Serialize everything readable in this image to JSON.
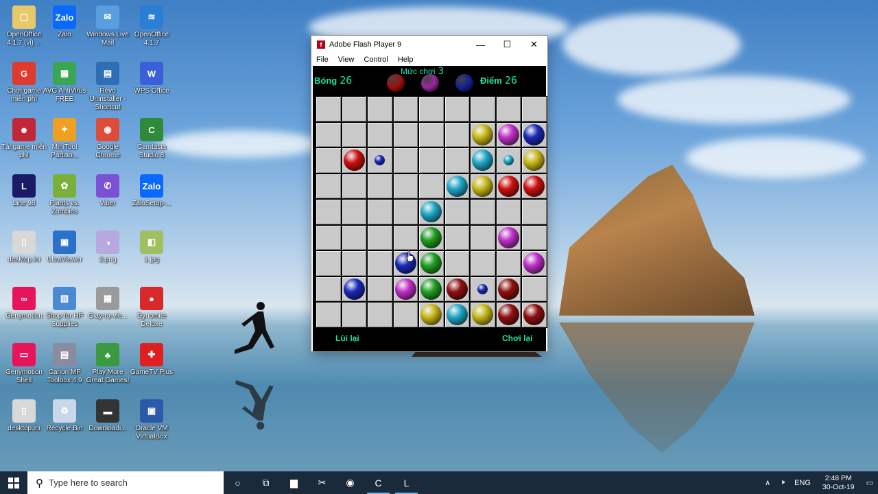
{
  "desktop": {
    "icons": [
      {
        "label": "OpenOffice 4.1.7 (vi) ...",
        "color": "#e8c86a",
        "glyph": "▢",
        "icon": "folder-icon"
      },
      {
        "label": "Zalo",
        "color": "#0a68ff",
        "glyph": "Zalo",
        "icon": "zalo-icon"
      },
      {
        "label": "Windows Live Mail",
        "color": "#5a9ee0",
        "glyph": "✉",
        "icon": "mail-icon"
      },
      {
        "label": "OpenOffice 4.1.7",
        "color": "#2a7fd4",
        "glyph": "≋",
        "icon": "openoffice-icon"
      },
      {
        "label": "Chơi game miễn phí",
        "color": "#e03a2e",
        "glyph": "G",
        "icon": "game-icon"
      },
      {
        "label": "AVG AntiVirus FREE",
        "color": "#3aa653",
        "glyph": "▦",
        "icon": "avg-icon"
      },
      {
        "label": "Revo Uninstaller - Shortcut",
        "color": "#2f6db5",
        "glyph": "▤",
        "icon": "revo-icon"
      },
      {
        "label": "WPS Office",
        "color": "#3b5fd9",
        "glyph": "W",
        "icon": "wps-icon"
      },
      {
        "label": "Tải game miễn phí",
        "color": "#c0283a",
        "glyph": "☻",
        "icon": "download-game-icon"
      },
      {
        "label": "MiniTool Partitio...",
        "color": "#f0a020",
        "glyph": "✦",
        "icon": "minitool-icon"
      },
      {
        "label": "Google Chrome",
        "color": "#dd4b39",
        "glyph": "◉",
        "icon": "chrome-icon"
      },
      {
        "label": "Camtasia Studio 8",
        "color": "#2e8b3a",
        "glyph": "C",
        "icon": "camtasia-icon"
      },
      {
        "label": "Line 98",
        "color": "#1a1a66",
        "glyph": "L",
        "icon": "line98-icon"
      },
      {
        "label": "Plants vs. Zombies",
        "color": "#7ab03a",
        "glyph": "✿",
        "icon": "pvz-icon"
      },
      {
        "label": "Viber",
        "color": "#7b51d3",
        "glyph": "✆",
        "icon": "viber-icon"
      },
      {
        "label": "ZaloSetup-...",
        "color": "#0a68ff",
        "glyph": "Zalo",
        "icon": "zalo-setup-icon"
      },
      {
        "label": "desktop.ini",
        "color": "#d8d8d8",
        "glyph": "▯",
        "icon": "file-icon"
      },
      {
        "label": "UltraViewer",
        "color": "#2a72c9",
        "glyph": "▣",
        "icon": "ultraviewer-icon"
      },
      {
        "label": "2.png",
        "color": "#b8a8e0",
        "glyph": "◑",
        "icon": "image-icon"
      },
      {
        "label": "1.jpg",
        "color": "#a0c060",
        "glyph": "◧",
        "icon": "photo-icon"
      },
      {
        "label": "Genymotion",
        "color": "#e8145b",
        "glyph": "∞",
        "icon": "genymotion-icon"
      },
      {
        "label": "Shop for HP Supplies",
        "color": "#4a8ad4",
        "glyph": "▥",
        "icon": "hp-icon"
      },
      {
        "label": "Giay-ra-vie...",
        "color": "#9a9a9a",
        "glyph": "▦",
        "icon": "document-icon"
      },
      {
        "label": "Dynomite Deluxe",
        "color": "#d8282a",
        "glyph": "●",
        "icon": "dynomite-icon"
      },
      {
        "label": "Genymotion Shell",
        "color": "#e8145b",
        "glyph": "▭",
        "icon": "genymotion-shell-icon"
      },
      {
        "label": "Canon MF Toolbox 4.9",
        "color": "#8a8aa0",
        "glyph": "▤",
        "icon": "canon-icon"
      },
      {
        "label": "Play More Great Games!",
        "color": "#3a9a40",
        "glyph": "♣",
        "icon": "games-icon"
      },
      {
        "label": "GameTV Plus",
        "color": "#e02020",
        "glyph": "✚",
        "icon": "gametv-icon"
      },
      {
        "label": "desktop.ini",
        "color": "#d8d8d8",
        "glyph": "▯",
        "icon": "file-icon"
      },
      {
        "label": "Recycle Bin",
        "color": "#c8d8e8",
        "glyph": "♻",
        "icon": "recycle-bin-icon"
      },
      {
        "label": "Downloadi...",
        "color": "#333333",
        "glyph": "▬",
        "icon": "download-icon"
      },
      {
        "label": "Oracle VM VirtualBox",
        "color": "#2a5aa8",
        "glyph": "▣",
        "icon": "virtualbox-icon"
      }
    ]
  },
  "window": {
    "title": "Adobe Flash Player 9",
    "controls": [
      "—",
      "☐",
      "✕"
    ],
    "menu": [
      "File",
      "View",
      "Control",
      "Help"
    ]
  },
  "game": {
    "balls_label": "Bóng",
    "balls_value": "26",
    "level_label": "Mức chơi",
    "level_value": "3",
    "score_label": "Điểm",
    "score_value": "26",
    "next_balls": [
      "red",
      "magenta",
      "blue"
    ],
    "undo_label": "Lùi lại",
    "replay_label": "Chơi lại",
    "colors": {
      "red": "#d01010",
      "magenta": "#c030c8",
      "blue": "#1a2ab8",
      "cyan": "#20a8c8",
      "yellow": "#c8b818",
      "green": "#20a020",
      "darkred": "#901010"
    },
    "board": [
      [
        "",
        "",
        "",
        "",
        "",
        "",
        "",
        "",
        ""
      ],
      [
        "",
        "",
        "",
        "",
        "",
        "",
        "yellow",
        "magenta",
        "blue"
      ],
      [
        "",
        "red",
        "s:blue",
        "",
        "",
        "",
        "cyan",
        "s:cyan",
        "yellow"
      ],
      [
        "",
        "",
        "",
        "",
        "",
        "cyan",
        "yellow",
        "red",
        "red"
      ],
      [
        "",
        "",
        "",
        "",
        "cyan",
        "",
        "",
        "",
        ""
      ],
      [
        "",
        "",
        "",
        "",
        "green",
        "",
        "",
        "magenta",
        ""
      ],
      [
        "",
        "",
        "",
        "blue",
        "green",
        "",
        "",
        "",
        "magenta"
      ],
      [
        "",
        "blue",
        "",
        "magenta",
        "green",
        "darkred",
        "s:blue",
        "darkred",
        ""
      ],
      [
        "",
        "",
        "",
        "",
        "yellow",
        "cyan",
        "yellow",
        "darkred",
        "darkred"
      ]
    ]
  },
  "taskbar": {
    "search_placeholder": "Type here to search",
    "apps": [
      {
        "icon": "cortana-icon",
        "glyph": "○"
      },
      {
        "icon": "task-view-icon",
        "glyph": "⧉"
      },
      {
        "icon": "file-explorer-icon",
        "glyph": "▆"
      },
      {
        "icon": "snipping-icon",
        "glyph": "✂"
      },
      {
        "icon": "chrome-taskbar-icon",
        "glyph": "◉"
      },
      {
        "icon": "camtasia-taskbar-icon",
        "glyph": "C"
      },
      {
        "icon": "line98-taskbar-icon",
        "glyph": "L"
      }
    ],
    "tray": {
      "chevron": "∧",
      "volume": "🕨",
      "language": "ENG",
      "time": "2:48 PM",
      "date": "30-Oct-19",
      "notification": "▭"
    }
  }
}
